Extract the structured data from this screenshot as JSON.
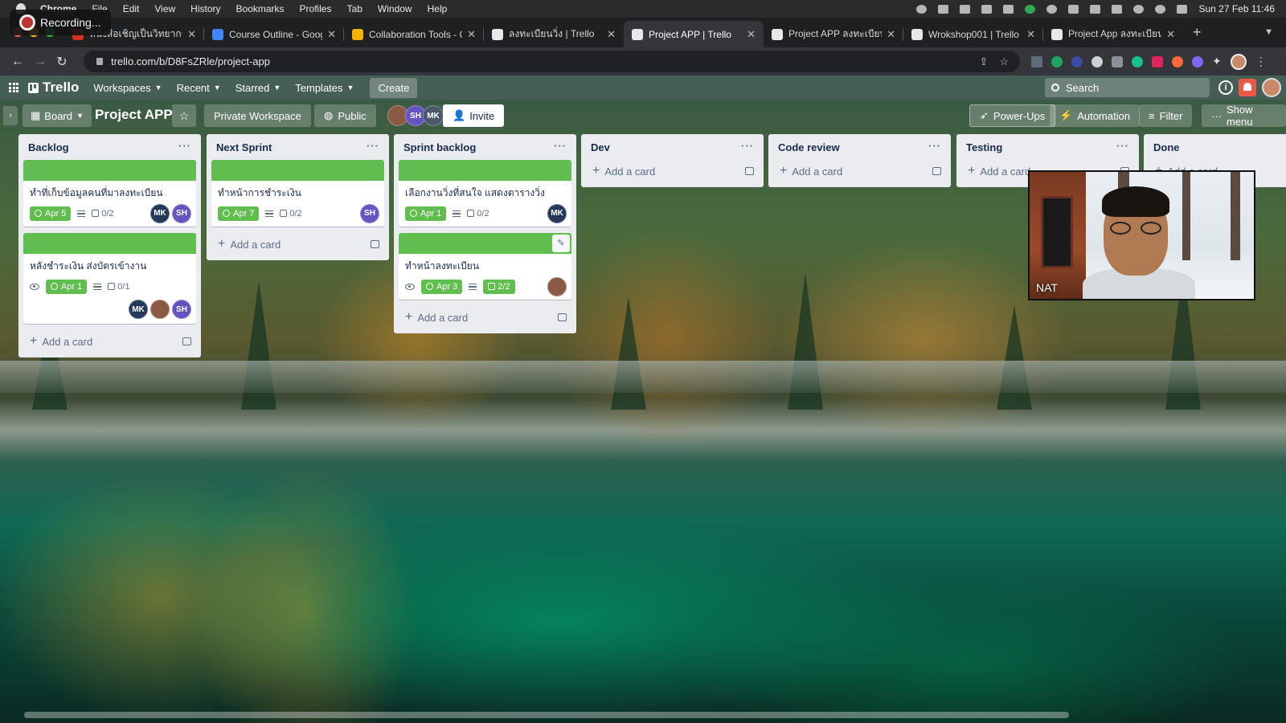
{
  "recording": {
    "label": "Recording..."
  },
  "menubar": {
    "items": [
      "Chrome",
      "File",
      "Edit",
      "View",
      "History",
      "Bookmarks",
      "Profiles",
      "Tab",
      "Window",
      "Help"
    ],
    "clock": "Sun 27 Feb  11:46"
  },
  "browser": {
    "tabs": [
      {
        "title": "หนังสือเชิญเป็นวิทยากร กิจกร",
        "favicon_color": "#d93025"
      },
      {
        "title": "Course Outline - Google D",
        "favicon_color": "#4285f4"
      },
      {
        "title": "Collaboration Tools - Goo",
        "favicon_color": "#f4b400"
      },
      {
        "title": "ลงทะเบียนวิ่ง | Trello",
        "favicon_color": "#e8e8e8"
      },
      {
        "title": "Project APP | Trello",
        "favicon_color": "#e8e8e8"
      },
      {
        "title": "Project APP ลงทะเบียนงาน",
        "favicon_color": "#e8e8e8"
      },
      {
        "title": "Wrokshop001 | Trello",
        "favicon_color": "#e8e8e8"
      },
      {
        "title": "Project App ลงทะเบียนงาน",
        "favicon_color": "#e8e8e8"
      }
    ],
    "active_tab": 4,
    "url": "trello.com/b/D8FsZRle/project-app"
  },
  "trello_header": {
    "logo": "Trello",
    "nav": [
      "Workspaces",
      "Recent",
      "Starred",
      "Templates"
    ],
    "create_label": "Create",
    "search_placeholder": "Search",
    "info_label": "i"
  },
  "board": {
    "view_label": "Board",
    "title": "Project APP",
    "workspace_label": "Private Workspace",
    "visibility_label": "Public",
    "members": [
      {
        "initials": "",
        "color": "#8a5a44"
      },
      {
        "initials": "SH",
        "color": "#6554c0"
      },
      {
        "initials": "MK",
        "color": "#4a5a6a"
      }
    ],
    "invite_label": "Invite",
    "powerups_label": "Power-Ups",
    "automation_label": "Automation",
    "filter_label": "Filter",
    "show_menu_label": "Show menu",
    "add_card_label": "Add a card"
  },
  "lists": [
    {
      "name": "Backlog",
      "cards": [
        {
          "title": "ทำที่เก็บข้อมูลคนที่มาลงทะเบียน",
          "due": "Apr 5",
          "checklist": "0/2",
          "members": [
            "MK",
            "SH"
          ]
        },
        {
          "title": "หลังชำระเงิน ส่งบัตรเข้างาน",
          "due": "Apr 1",
          "checklist": "0/1",
          "members": [
            "MK",
            "",
            "SH"
          ]
        }
      ]
    },
    {
      "name": "Next Sprint",
      "cards": [
        {
          "title": "ทำหน้าการชำระเงิน",
          "due": "Apr 7",
          "checklist": "0/2",
          "members": [
            "SH"
          ]
        }
      ]
    },
    {
      "name": "Sprint backlog",
      "cards": [
        {
          "title": "เลือกงานวิ่งที่สนใจ แสดงตารางวิ่ง",
          "due": "Apr 1",
          "checklist": "0/2",
          "members": [
            "MK"
          ]
        },
        {
          "title": "ทำหน้าลงทะเบียน",
          "due": "Apr 3",
          "checklist": "2/2",
          "members": [
            ""
          ]
        }
      ]
    },
    {
      "name": "Dev",
      "cards": []
    },
    {
      "name": "Code review",
      "cards": []
    },
    {
      "name": "Testing",
      "cards": []
    },
    {
      "name": "Done",
      "cards": []
    }
  ],
  "video": {
    "participant_name": "NAT"
  },
  "colors": {
    "green": "#61bd4f",
    "sh_avatar": "#6554c0",
    "mk_avatar": "#253858"
  }
}
